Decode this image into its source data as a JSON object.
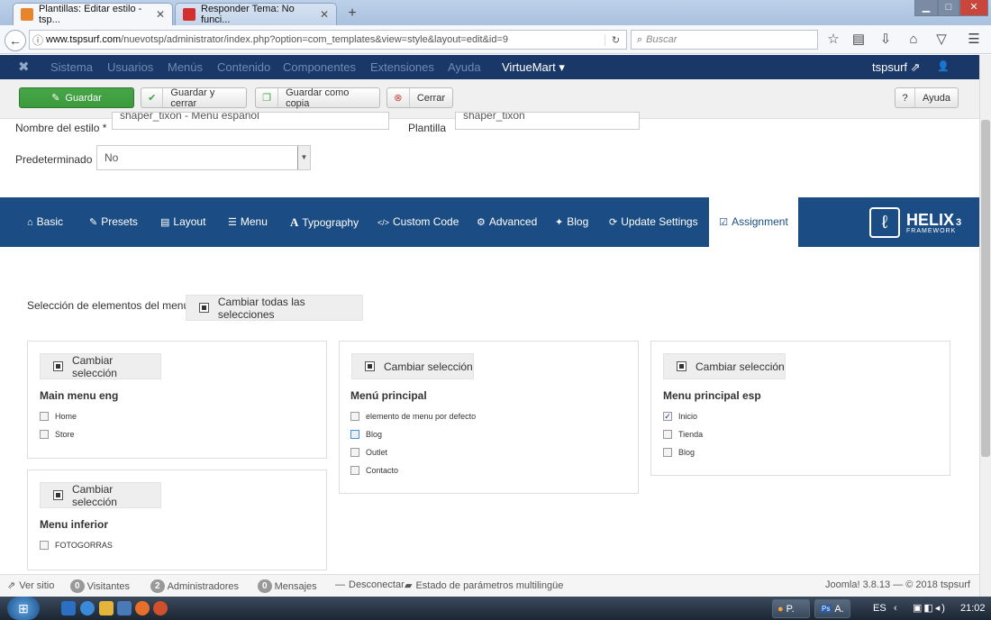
{
  "browser": {
    "tabs": [
      {
        "title": "Plantillas: Editar estilo - tsp...",
        "active": true
      },
      {
        "title": "Responder Tema: No funci...",
        "active": false
      }
    ],
    "new_tab": "+",
    "url_domain": "www.tspsurf.com",
    "url_rest": "/nuevotsp/administrator/index.php?option=com_templates&view=style&layout=edit&id=9",
    "search_placeholder": "Buscar",
    "window_buttons": {
      "minimize": "▁",
      "maximize": "□",
      "close": "✕"
    }
  },
  "admin_menu": {
    "items": [
      "Sistema",
      "Usuarios",
      "Menús",
      "Contenido",
      "Componentes",
      "Extensiones",
      "Ayuda"
    ],
    "virtuemart": "VirtueMart ▾",
    "user": "tspsurf ⇗",
    "user_icon": "👤"
  },
  "toolbar": {
    "save": "Guardar",
    "save_close": "Guardar y cerrar",
    "save_copy": "Guardar como copia",
    "close": "Cerrar",
    "help": "Ayuda"
  },
  "form": {
    "style_name_label": "Nombre del estilo *",
    "style_name_value": "shaper_tixon - Menú español",
    "template_label": "Plantilla",
    "template_value": "shaper_tixon",
    "default_label": "Predeterminado",
    "default_value": "No"
  },
  "helix": {
    "tabs": [
      {
        "label": "Basic",
        "icon": "home-icon",
        "glyph": "⌂"
      },
      {
        "label": "Presets",
        "icon": "brush-icon",
        "glyph": "✎"
      },
      {
        "label": "Layout",
        "icon": "layout-icon",
        "glyph": "▤"
      },
      {
        "label": "Menu",
        "icon": "list-icon",
        "glyph": "☰"
      },
      {
        "label": "Typography",
        "icon": "font-icon",
        "glyph": "A"
      },
      {
        "label": "Custom Code",
        "icon": "code-icon",
        "glyph": "</>"
      },
      {
        "label": "Advanced",
        "icon": "cog-icon",
        "glyph": "⚙"
      },
      {
        "label": "Blog",
        "icon": "pin-icon",
        "glyph": "✦"
      },
      {
        "label": "Update Settings",
        "icon": "refresh-icon",
        "glyph": "⟳"
      },
      {
        "label": "Assignment",
        "icon": "check-square-icon",
        "glyph": "☑"
      }
    ],
    "logo_text": "HELIX",
    "logo_num": "3",
    "logo_sub": "FRAMEWORK"
  },
  "assignment": {
    "label": "Selección de elementos del menú:",
    "toggle_all": "Cambiar todas las selecciones",
    "toggle": "Cambiar selección",
    "panels": [
      {
        "title": "Main menu eng",
        "items": [
          {
            "label": "Home",
            "checked": false
          },
          {
            "label": "Store",
            "checked": false
          }
        ]
      },
      {
        "title": "Menú principal",
        "items": [
          {
            "label": "elemento de menu por defecto",
            "checked": false
          },
          {
            "label": "Blog",
            "checked": false
          },
          {
            "label": "Outlet",
            "checked": false
          },
          {
            "label": "Contacto",
            "checked": false
          }
        ]
      },
      {
        "title": "Menu principal esp",
        "items": [
          {
            "label": "Inicio",
            "checked": true
          },
          {
            "label": "Tienda",
            "checked": false
          },
          {
            "label": "Blog",
            "checked": false
          }
        ]
      },
      {
        "title": "Menu inferior",
        "items": [
          {
            "label": "FOTOGORRAS",
            "checked": false
          }
        ]
      }
    ]
  },
  "statusbar": {
    "view_site": "Ver sitio",
    "visitors_count": "0",
    "visitors": "Visitantes",
    "admins_count": "2",
    "admins": "Administradores",
    "messages_count": "0",
    "messages": "Mensajes",
    "logout": "Desconectar",
    "multilang": "Estado de parámetros multilingüe",
    "version": "Joomla! 3.8.13 — © 2018 tspsurf"
  },
  "taskbar": {
    "task1": "P.",
    "task2": "A.",
    "lang": "ES",
    "time": "21:02"
  }
}
